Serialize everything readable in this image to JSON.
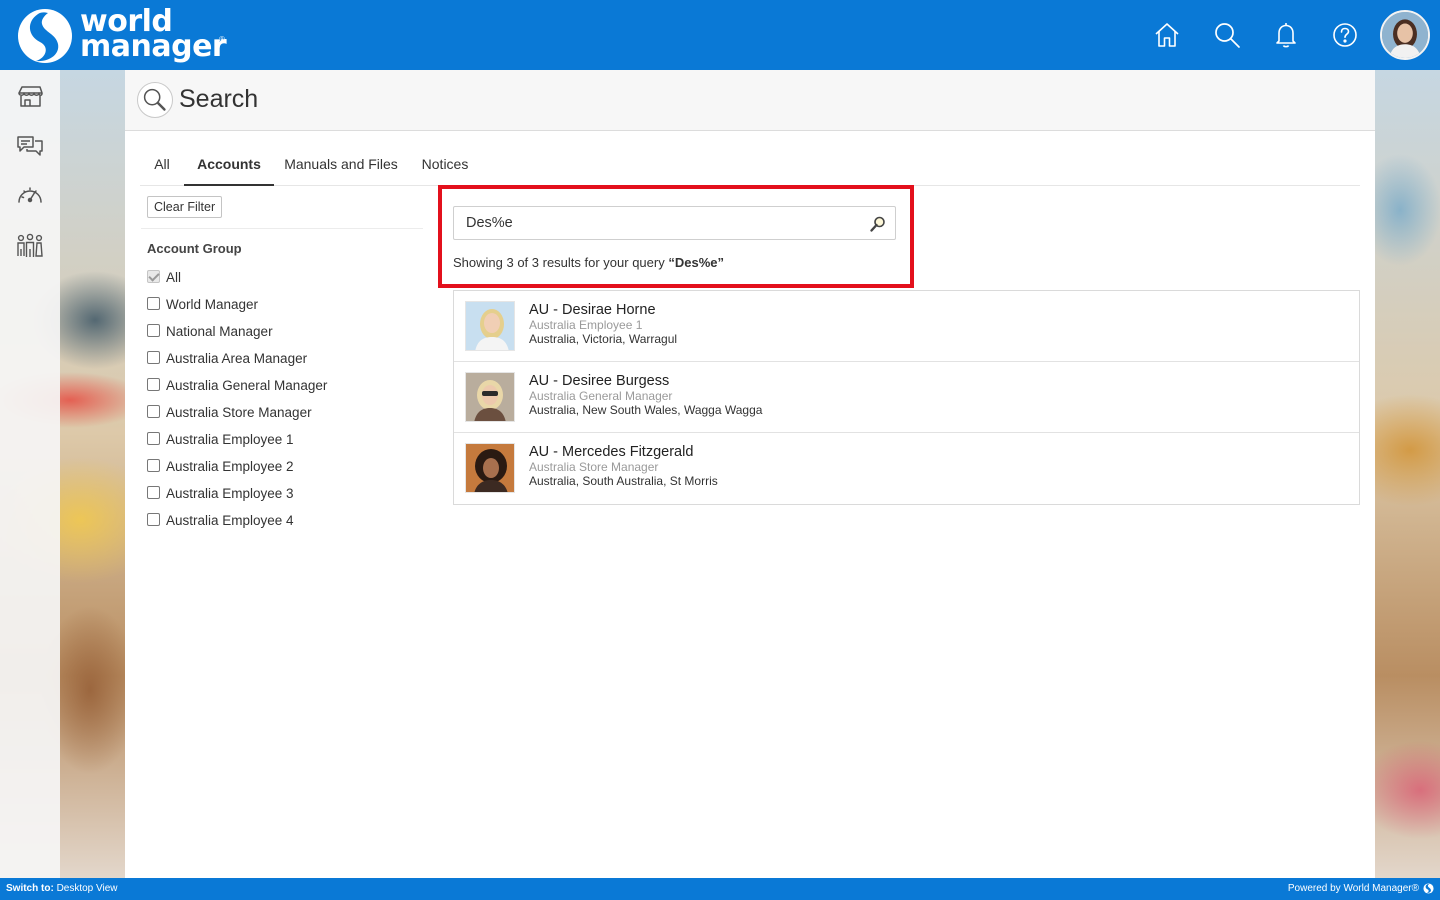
{
  "header": {
    "logo_line1": "world",
    "logo_line2": "manager",
    "logo_reg": "®",
    "brand_color": "#0a79d6",
    "icons": [
      "home-icon",
      "search-icon",
      "bell-icon",
      "help-icon"
    ]
  },
  "sidebar": {
    "icons": [
      "store-icon",
      "chat-icon",
      "dashboard-icon",
      "people-icon"
    ],
    "expand_glyph": "»"
  },
  "page": {
    "title": "Search"
  },
  "tabs": [
    {
      "label": "All",
      "active": false
    },
    {
      "label": "Accounts",
      "active": true
    },
    {
      "label": "Manuals and Files",
      "active": false
    },
    {
      "label": "Notices",
      "active": false
    }
  ],
  "filters": {
    "clear_label": "Clear Filter",
    "group_title": "Account Group",
    "items": [
      {
        "label": "All",
        "checked": true
      },
      {
        "label": "World Manager",
        "checked": false
      },
      {
        "label": "National Manager",
        "checked": false
      },
      {
        "label": "Australia Area Manager",
        "checked": false
      },
      {
        "label": "Australia General Manager",
        "checked": false
      },
      {
        "label": "Australia Store Manager",
        "checked": false
      },
      {
        "label": "Australia Employee 1",
        "checked": false
      },
      {
        "label": "Australia Employee 2",
        "checked": false
      },
      {
        "label": "Australia Employee 3",
        "checked": false
      },
      {
        "label": "Australia Employee 4",
        "checked": false
      }
    ]
  },
  "search": {
    "query": "Des%e",
    "summary_prefix": "Showing 3 of 3 results for your query ",
    "summary_query": "“Des%e”",
    "highlight_color": "#e3101c"
  },
  "results": [
    {
      "name": "AU - Desirae Horne",
      "role": "Australia Employee 1",
      "location": "Australia, Victoria, Warragul"
    },
    {
      "name": "AU - Desiree Burgess",
      "role": "Australia General Manager",
      "location": "Australia, New South Wales, Wagga Wagga"
    },
    {
      "name": "AU - Mercedes Fitzgerald",
      "role": "Australia Store Manager",
      "location": "Australia, South Australia, St Morris"
    }
  ],
  "footer": {
    "switch_label": "Switch to:",
    "switch_target": "Desktop View",
    "powered_by": "Powered by World Manager®"
  }
}
